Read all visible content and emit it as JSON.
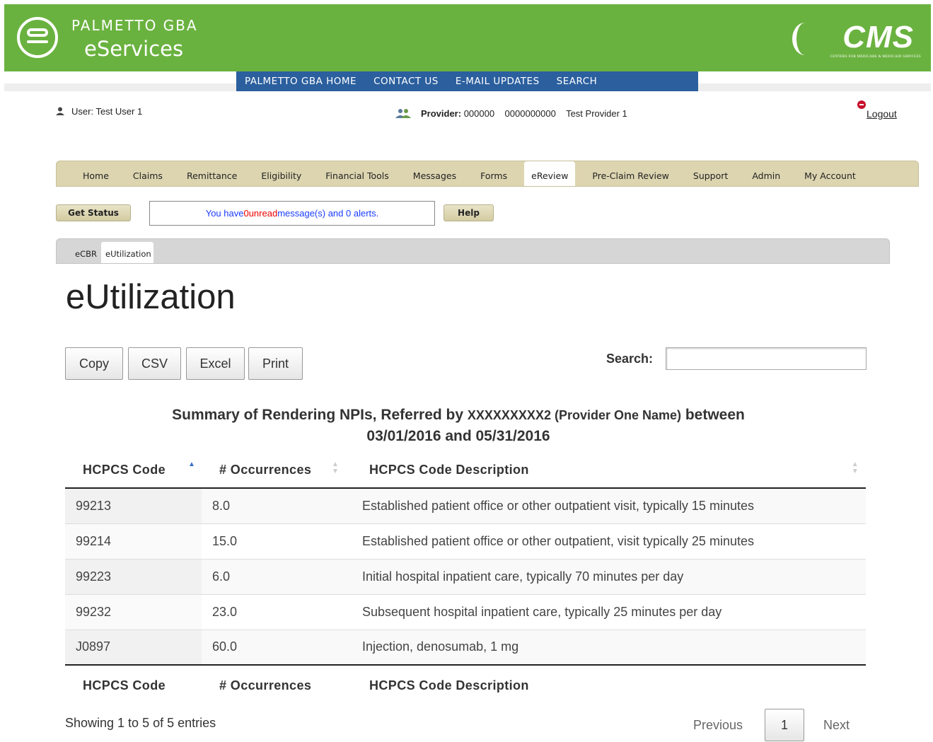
{
  "brand": {
    "top": "PALMETTO GBA",
    "bottom": "eServices",
    "cms": "CMS",
    "cms_sub": "CENTERS FOR MEDICARE & MEDICAID SERVICES"
  },
  "topnav": [
    "PALMETTO GBA HOME",
    "CONTACT US",
    "E-MAIL UPDATES",
    "SEARCH"
  ],
  "user": {
    "label": "User:",
    "name": "Test User 1"
  },
  "provider": {
    "label": "Provider:",
    "id1": "000000",
    "id2": "0000000000",
    "name": "Test Provider 1"
  },
  "logout": "Logout",
  "mainnav": [
    "Home",
    "Claims",
    "Remittance",
    "Eligibility",
    "Financial Tools",
    "Messages",
    "Forms",
    "eReview",
    "Pre-Claim Review",
    "Support",
    "Admin",
    "My Account"
  ],
  "mainnav_active": "eReview",
  "get_status": "Get Status",
  "message": {
    "pre": "You have ",
    "unread_count": "0",
    "unread_label": " unread",
    "mid": " message(s) and 0 alerts."
  },
  "help": "Help",
  "subtabs": [
    "eCBR",
    "eUtilization"
  ],
  "page_title": "eUtilization",
  "buttons": {
    "copy": "Copy",
    "csv": "CSV",
    "excel": "Excel",
    "print": "Print"
  },
  "search": {
    "label": "Search:",
    "value": ""
  },
  "caption": {
    "part1": "Summary of Rendering NPIs, Referred by ",
    "npi": "XXXXXXXXX2 (Provider One Name)",
    "part2": " between",
    "line2": "03/01/2016 and 05/31/2016"
  },
  "table": {
    "headers": [
      "HCPCS Code",
      "# Occurrences",
      "HCPCS Code Description"
    ],
    "rows": [
      [
        "99213",
        "8.0",
        "Established patient office or other outpatient visit, typically 15 minutes"
      ],
      [
        "99214",
        "15.0",
        "Established patient office or other outpatient, visit typically 25 minutes"
      ],
      [
        "99223",
        "6.0",
        "Initial hospital inpatient care, typically 70 minutes per day"
      ],
      [
        "99232",
        "23.0",
        "Subsequent hospital inpatient care, typically 25 minutes per day"
      ],
      [
        "J0897",
        "60.0",
        "Injection, denosumab, 1 mg"
      ]
    ]
  },
  "footer": {
    "info": "Showing 1 to 5 of 5 entries",
    "previous": "Previous",
    "page": "1",
    "next": "Next"
  },
  "colors": {
    "header_green": "#6ab23f",
    "nav_blue": "#2b5f9e",
    "tab_tan": "#ddd5b0"
  }
}
